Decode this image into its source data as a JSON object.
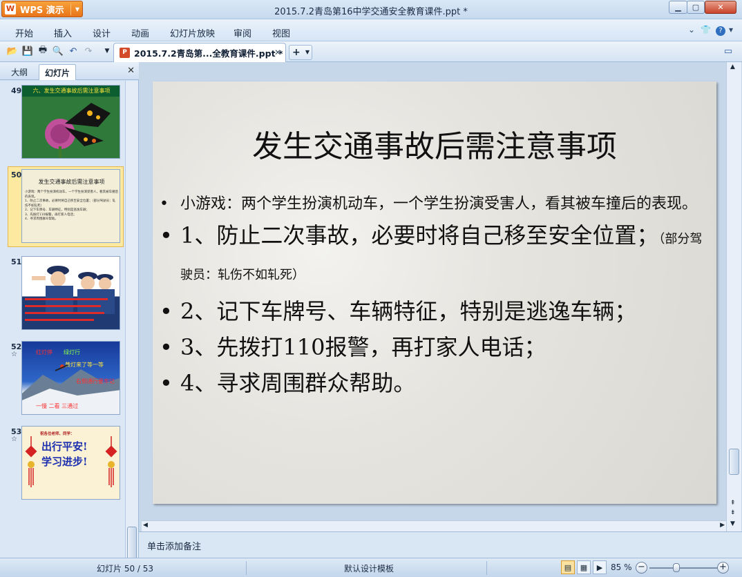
{
  "window": {
    "app_button_label": "WPS 演示",
    "title": "2015.7.2青岛第16中学交通安全教育课件.ppt *"
  },
  "menu": [
    "开始",
    "插入",
    "设计",
    "动画",
    "幻灯片放映",
    "审阅",
    "视图"
  ],
  "document_tab": {
    "label": "2015.7.2青岛第...全教育课件.ppt *"
  },
  "left_pane": {
    "tabs": [
      "大纲",
      "幻灯片"
    ],
    "active_tab": "幻灯片",
    "thumbnails": [
      {
        "number": "49",
        "title": "六、发生交通事故后需注意事项",
        "has_anim_icon": false
      },
      {
        "number": "50",
        "title": "发生交通事故后需注意事项",
        "selected": true,
        "has_anim_icon": false,
        "lines": [
          "小游戏：两个学生扮演机动车，一个学生扮演受害人，看其被车撞后的表现。",
          "1、防止二次事故，必要时将自己移至安全位置；（部分驾驶员：轧伤不如轧死）",
          "2、记下车牌号、车辆特征，特别是逃逸车辆；",
          "3、先拨打110报警，再打家人电话；",
          "4、寻求周围群众帮助。"
        ]
      },
      {
        "number": "51",
        "title": "",
        "has_anim_icon": false
      },
      {
        "number": "52",
        "title": "",
        "has_anim_icon": true,
        "texts": [
          "红灯停",
          "绿灯行",
          "黄灯来了等一等",
          "右侧通行要牢记",
          "一慢 二看 三通过"
        ]
      },
      {
        "number": "53",
        "title": "",
        "has_anim_icon": true,
        "texts": [
          "祝各位老师、同学：",
          "出行平安!",
          "学习进步!"
        ]
      }
    ]
  },
  "slide": {
    "title": "发生交通事故后需注意事项",
    "bullets": [
      {
        "text": "小游戏：两个学生扮演机动车，一个学生扮演受害人，看其被车撞后的表现。",
        "size": "small"
      },
      {
        "text": "1、防止二次事故，必要时将自己移至安全位置；",
        "note": "（部分驾驶员：轧伤不如轧死）",
        "size": "big"
      },
      {
        "text": "2、记下车牌号、车辆特征，特别是逃逸车辆；",
        "size": "big"
      },
      {
        "text": "3、先拨打110报警，再打家人电话；",
        "size": "big"
      },
      {
        "text": "4、寻求周围群众帮助。",
        "size": "big"
      }
    ]
  },
  "notes_placeholder": "单击添加备注",
  "status": {
    "slide_indicator": "幻灯片 50 / 53",
    "template": "默认设计模板",
    "zoom": "85 %"
  }
}
